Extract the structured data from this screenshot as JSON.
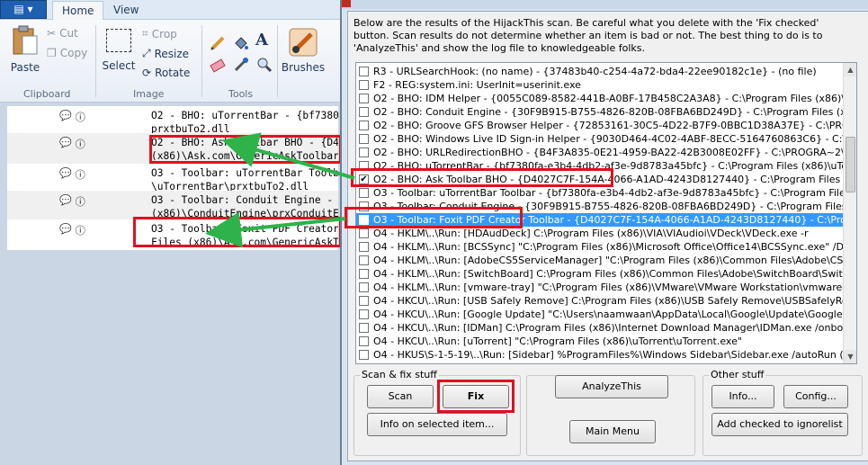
{
  "paint": {
    "file_menu": "▤ ▾",
    "tabs": [
      "Home",
      "View"
    ],
    "clipboard": {
      "paste": "Paste",
      "cut": "Cut",
      "copy": "Copy",
      "label": "Clipboard"
    },
    "image": {
      "select": "Select",
      "crop": "Crop",
      "resize": "Resize",
      "rotate": "Rotate",
      "label": "Image"
    },
    "tools": {
      "label": "Tools",
      "text_glyph": "A"
    },
    "brushes": "Brushes",
    "log_rows": [
      [
        "O2 - BHO: uTorrentBar - {bf7380fa-",
        "prxtbuTo2.dll"
      ],
      [
        "O2 - BHO: Ask Toolbar BHO - {D402",
        "(x86)\\Ask.com\\GenericAskToolbar.d"
      ],
      [
        "O3 - Toolbar: uTorrentBar Toolbar",
        "\\uTorrentBar\\prxtbuTo2.dll"
      ],
      [
        "O3 - Toolbar: Conduit Engine - {30F",
        "(x86)\\ConduitEngine\\prxConduitEngi"
      ],
      [
        "O3 - Toolbar: Foxit PDF Creator Tool",
        "Files (x86)\\Ask.com\\GenericAskToolb"
      ]
    ]
  },
  "hijackthis": {
    "intro": "Below are the results of the HijackThis scan. Be careful what you delete with the 'Fix checked' button. Scan results do not determine whether an item is bad or not. The best thing to do is to 'AnalyzeThis' and show the log file to knowledgeable folks.",
    "items": [
      {
        "text": "R3 - URLSearchHook: (no name) - {37483b40-c254-4a72-bda4-22ee90182c1e} - (no file)",
        "checked": ""
      },
      {
        "text": "F2 - REG:system.ini: UserInit=userinit.exe",
        "checked": ""
      },
      {
        "text": "O2 - BHO: IDM Helper - {0055C089-8582-441B-A0BF-17B458C2A3A8} - C:\\Program Files (x86)\\Internet Download",
        "checked": ""
      },
      {
        "text": "O2 - BHO: Conduit Engine - {30F9B915-B755-4826-820B-08FBA6BD249D} - C:\\Program Files (x86)\\ConduitEngine",
        "checked": ""
      },
      {
        "text": "O2 - BHO: Groove GFS Browser Helper - {72853161-30C5-4D22-B7F9-0BBC1D38A37E} - C:\\PROGRA~2\\MICROS~",
        "checked": ""
      },
      {
        "text": "O2 - BHO: Windows Live ID Sign-in Helper - {9030D464-4C02-4ABF-8ECC-5164760863C6} - C:\\Program Files (x86)",
        "checked": ""
      },
      {
        "text": "O2 - BHO: URLRedirectionBHO - {B4F3A835-0E21-4959-BA22-42B3008E02FF} - C:\\PROGRA~2\\MICROS~3\\Office",
        "checked": ""
      },
      {
        "text": "O2 - BHO: uTorrentBar - {bf7380fa-e3b4-4db2-af3e-9d8783a45bfc} - C:\\Program Files (x86)\\uTorrentBar\\prxtb",
        "checked": ""
      },
      {
        "text": "O2 - BHO: Ask Toolbar BHO - {D4027C7F-154A-4066-A1AD-4243D8127440} - C:\\Program Files (x86)\\Ask.com\\",
        "checked": "✔"
      },
      {
        "text": "O3 - Toolbar: uTorrentBar Toolbar - {bf7380fa-e3b4-4db2-af3e-9d8783a45bfc} - C:\\Program Files (x86)\\uTorr",
        "checked": ""
      },
      {
        "text": "O3 - Toolbar: Conduit Engine - {30F9B915-B755-4826-820B-08FBA6BD249D} - C:\\Program Files (x86)\\ConduitE",
        "checked": ""
      },
      {
        "text": "O3 - Toolbar: Foxit PDF Creator Toolbar - {D4027C7F-154A-4066-A1AD-4243D8127440} - C:\\Program Files (x86",
        "checked": "✔"
      },
      {
        "text": "O4 - HKLM\\..\\Run: [HDAudDeck] C:\\Program Files (x86)\\VIA\\VIAudioi\\VDeck\\VDeck.exe -r",
        "checked": ""
      },
      {
        "text": "O4 - HKLM\\..\\Run: [BCSSync] \"C:\\Program Files (x86)\\Microsoft Office\\Office14\\BCSSync.exe\" /DelayServices",
        "checked": ""
      },
      {
        "text": "O4 - HKLM\\..\\Run: [AdobeCS5ServiceManager] \"C:\\Program Files (x86)\\Common Files\\Adobe\\CS5ServiceManag",
        "checked": ""
      },
      {
        "text": "O4 - HKLM\\..\\Run: [SwitchBoard] C:\\Program Files (x86)\\Common Files\\Adobe\\SwitchBoard\\SwitchBoard.exe",
        "checked": ""
      },
      {
        "text": "O4 - HKLM\\..\\Run: [vmware-tray] \"C:\\Program Files (x86)\\VMware\\VMware Workstation\\vmware-tray.exe\"",
        "checked": ""
      },
      {
        "text": "O4 - HKCU\\..\\Run: [USB Safely Remove] C:\\Program Files (x86)\\USB Safely Remove\\USBSafelyRemove.exe /st",
        "checked": ""
      },
      {
        "text": "O4 - HKCU\\..\\Run: [Google Update] \"C:\\Users\\naamwaan\\AppData\\Local\\Google\\Update\\GoogleUpdate.exe\" /",
        "checked": ""
      },
      {
        "text": "O4 - HKCU\\..\\Run: [IDMan] C:\\Program Files (x86)\\Internet Download Manager\\IDMan.exe /onboot",
        "checked": ""
      },
      {
        "text": "O4 - HKCU\\..\\Run: [uTorrent] \"C:\\Program Files (x86)\\uTorrent\\uTorrent.exe\"",
        "checked": ""
      },
      {
        "text": "O4 - HKUS\\S-1-5-19\\..\\Run: [Sidebar] %ProgramFiles%\\Windows Sidebar\\Sidebar.exe /autoRun (User 'LOCAL",
        "checked": ""
      }
    ],
    "scan_group": "Scan & fix stuff",
    "other_group": "Other stuff",
    "buttons": {
      "scan": "Scan",
      "fix_checked": "Fix checked",
      "info_selected": "Info on selected item...",
      "analyze": "AnalyzeThis",
      "main_menu": "Main Menu",
      "info": "Info...",
      "config": "Config...",
      "ignorelist": "Add checked to ignorelist"
    }
  },
  "colors": {
    "annotation_red": "#e01020",
    "annotation_green": "#2db34a",
    "selection_blue": "#3399ff"
  }
}
